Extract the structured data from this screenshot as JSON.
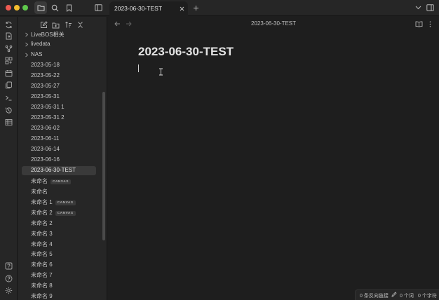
{
  "colors": {
    "close": "#ee5a52",
    "minimize": "#f5be2f",
    "zoom": "#5fc94c",
    "active_row": "#3a3a3a"
  },
  "tab": {
    "title": "2023-06-30-TEST"
  },
  "view": {
    "title": "2023-06-30-TEST"
  },
  "editor": {
    "doc_title": "2023-06-30-TEST"
  },
  "tree": [
    {
      "label": "LiveBOS相关",
      "folder": true
    },
    {
      "label": "livedata",
      "folder": true
    },
    {
      "label": "NAS",
      "folder": true
    },
    {
      "label": "2023-05-18"
    },
    {
      "label": "2023-05-22"
    },
    {
      "label": "2023-05-27"
    },
    {
      "label": "2023-05-31"
    },
    {
      "label": "2023-05-31 1"
    },
    {
      "label": "2023-05-31 2"
    },
    {
      "label": "2023-06-02"
    },
    {
      "label": "2023-06-11"
    },
    {
      "label": "2023-06-14"
    },
    {
      "label": "2023-06-16"
    },
    {
      "label": "2023-06-30-TEST",
      "active": true
    },
    {
      "label": "未命名",
      "badge": "CANVAS"
    },
    {
      "label": "未命名"
    },
    {
      "label": "未命名 1",
      "badge": "CANVAS"
    },
    {
      "label": "未命名 2",
      "badge": "CANVAS"
    },
    {
      "label": "未命名 2"
    },
    {
      "label": "未命名 3"
    },
    {
      "label": "未命名 4"
    },
    {
      "label": "未命名 5"
    },
    {
      "label": "未命名 6"
    },
    {
      "label": "未命名 7"
    },
    {
      "label": "未命名 8"
    },
    {
      "label": "未命名 9"
    }
  ],
  "status": {
    "backlinks": "0 条反向链接",
    "words": "0 个词",
    "chars": "0 个字符"
  }
}
